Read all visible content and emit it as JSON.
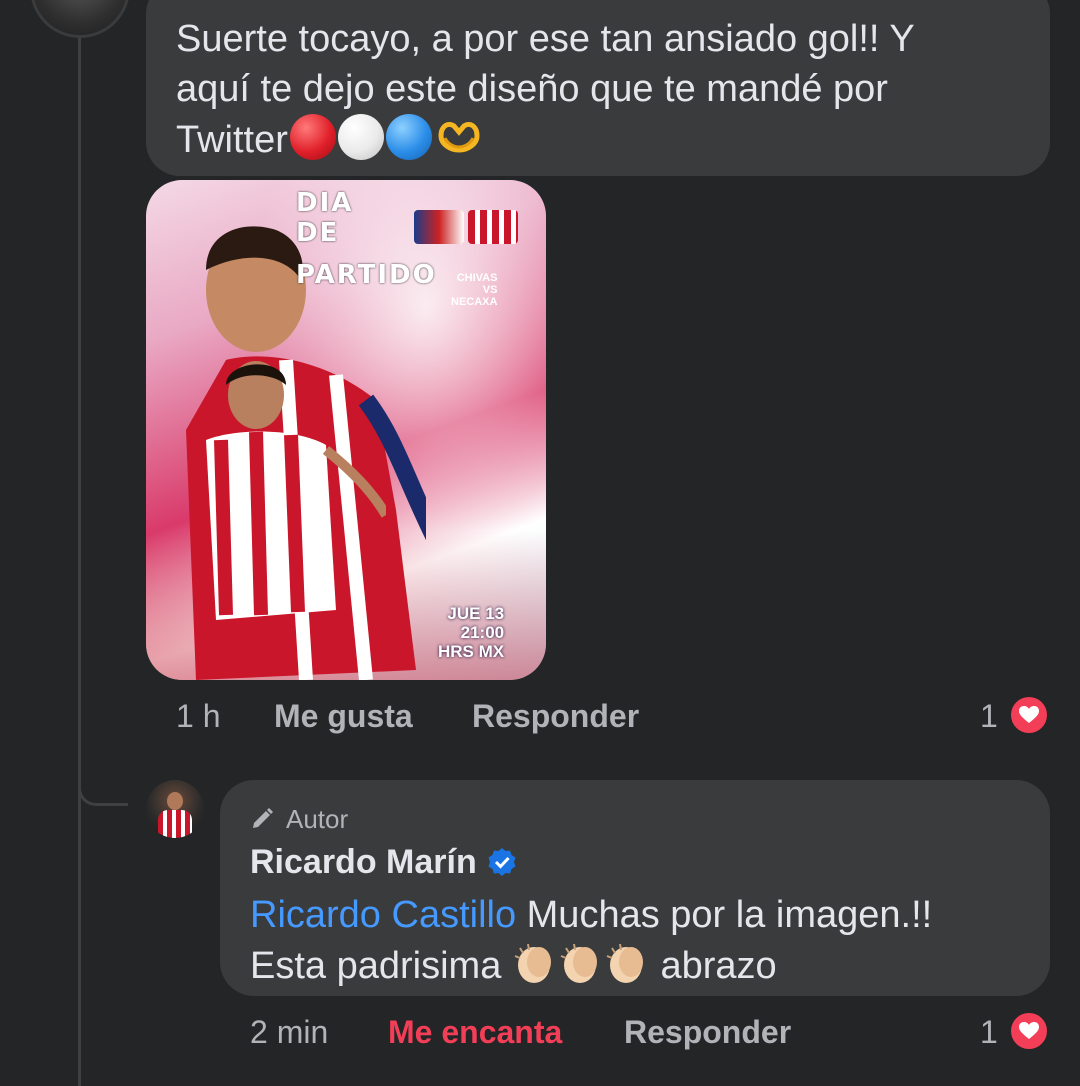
{
  "comment": {
    "text_line1": "Suerte tocayo, a por ese tan ansiado gol!! Y",
    "text_line2": "aquí te dejo este diseño que te mandé por",
    "text_line3": "Twitter",
    "emojis": [
      "red-circle",
      "white-circle",
      "blue-circle",
      "heart-hands"
    ],
    "image": {
      "title_lines": [
        "DIA",
        "DE",
        "PARTIDO"
      ],
      "matchup_lines": [
        "CHIVAS",
        "VS",
        "NECAXA"
      ],
      "date_lines": [
        "JUE 13",
        "21:00",
        "HRS MX"
      ]
    },
    "time": "1 h",
    "like_label": "Me gusta",
    "reply_label": "Responder",
    "reaction_count": "1",
    "reaction_type": "heart"
  },
  "reply": {
    "author_badge": "Autor",
    "author_name": "Ricardo Marín",
    "verified": true,
    "mention": "Ricardo Castillo",
    "text_after_mention": " Muchas por la imagen.!!",
    "text_line2_start": "Esta padrisima ",
    "emojis": [
      "clapping-hands",
      "clapping-hands",
      "clapping-hands"
    ],
    "text_line2_end": " abrazo",
    "time": "2 min",
    "reacted_label": "Me encanta",
    "reply_label": "Responder",
    "reaction_count": "1",
    "reaction_type": "heart"
  },
  "colors": {
    "background": "#242526",
    "bubble": "#3a3b3c",
    "text": "#e4e6eb",
    "secondary_text": "#b0b3b8",
    "mention": "#4599ff",
    "love_red": "#f33e58"
  }
}
